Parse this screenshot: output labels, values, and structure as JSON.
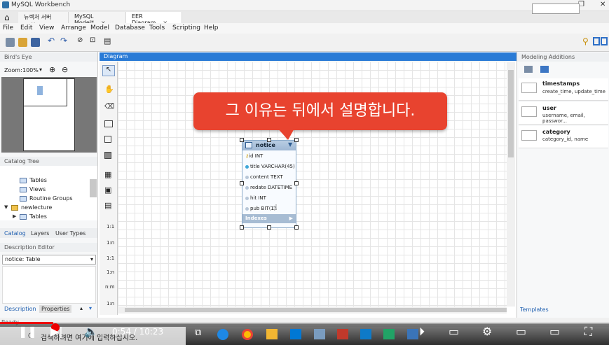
{
  "window": {
    "title": "MySQL Workbench",
    "controls": [
      "—",
      "❐",
      "✕"
    ]
  },
  "tabs": [
    {
      "label": "뉴렉처 서버"
    },
    {
      "label": "MySQL Model*"
    },
    {
      "label": "EER Diagram"
    }
  ],
  "menu": [
    "File",
    "Edit",
    "View",
    "Arrange",
    "Model",
    "Database",
    "Tools",
    "Scripting",
    "Help"
  ],
  "left": {
    "birds_eye": "Bird's Eye",
    "zoom_label": "Zoom:",
    "zoom_value": "100%",
    "catalog_tree": "Catalog Tree",
    "tree_items": [
      "Tables",
      "Views",
      "Routine Groups",
      "newlecture",
      "Tables"
    ],
    "tabs": [
      "Catalog",
      "Layers",
      "User Types"
    ],
    "description_editor": "Description Editor",
    "description_select": "notice: Table",
    "bottom_tabs": [
      "Description",
      "Properties"
    ]
  },
  "diagram": {
    "header": "Diagram",
    "table": {
      "name": "notice",
      "columns": [
        "id INT",
        "title VARCHAR(45)",
        "content TEXT",
        "redate DATETIME",
        "hit INT",
        "pub BIT(1)"
      ],
      "indexes_label": "Indexes"
    },
    "callout": "그 이유는 뒤에서 설명합니다."
  },
  "palette_labels": [
    "1:1",
    "1:n",
    "1:1",
    "1:n",
    "n:m",
    "1:n"
  ],
  "right": {
    "header": "Modeling Additions",
    "items": [
      {
        "title": "timestamps",
        "sub": "create_time, update_time"
      },
      {
        "title": "user",
        "sub": "username, email, passwor..."
      },
      {
        "title": "category",
        "sub": "category_id, name"
      }
    ],
    "templates": "Templates"
  },
  "status": "Ready",
  "video": {
    "time": "0:54 / 10:23",
    "progress": 0.087,
    "search_placeholder": "검색하려면 여기에 입력하십시오."
  },
  "colors": {
    "diagram_header": "#2a7bd6",
    "callout": "#e8432f",
    "progress": "#ee0000"
  }
}
